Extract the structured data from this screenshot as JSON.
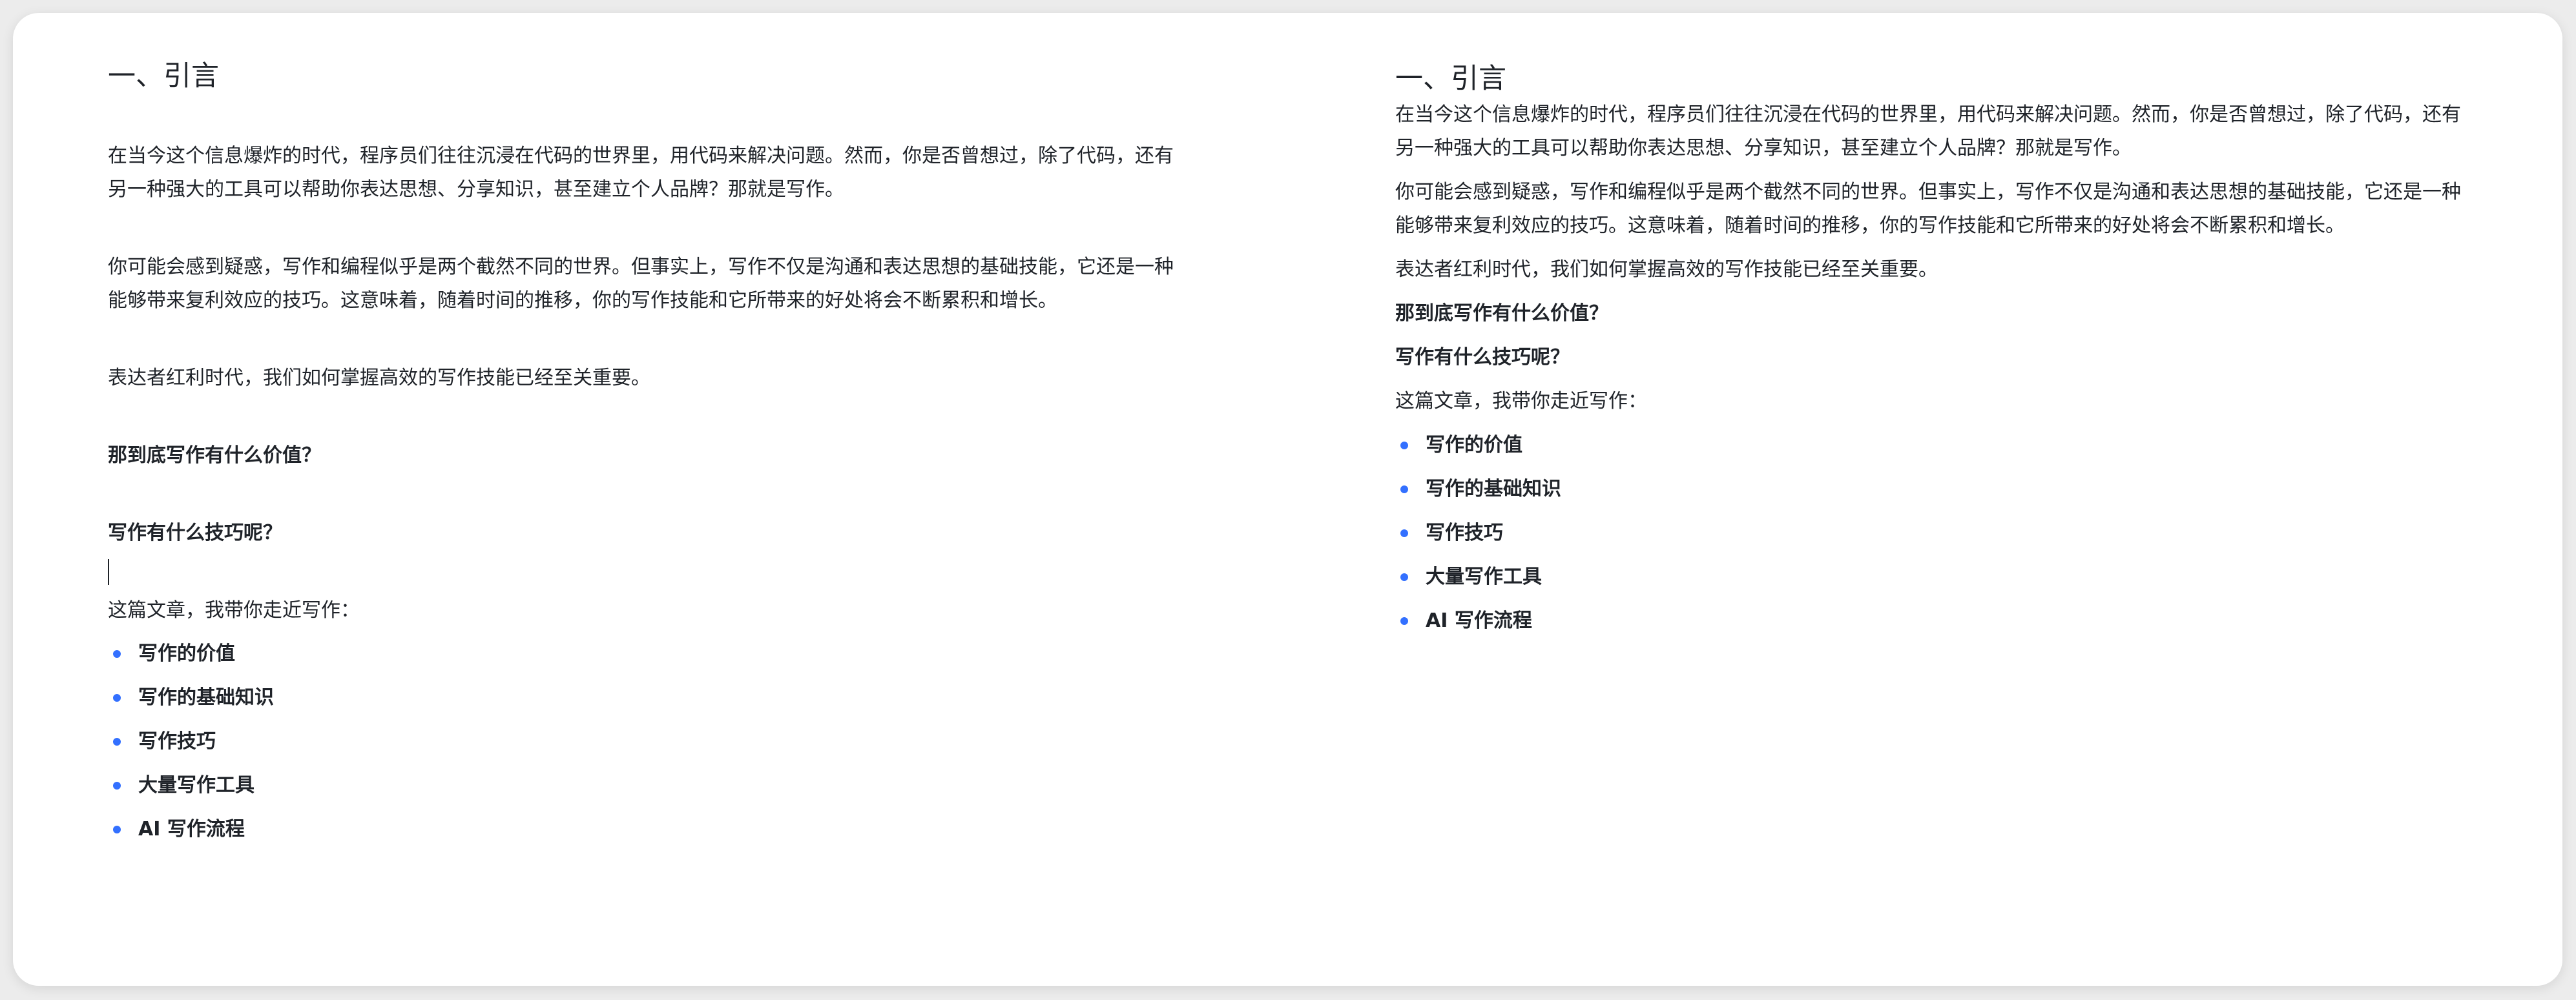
{
  "colors": {
    "text": "#1f2329",
    "bullet": "#3370ff",
    "card_bg": "#ffffff",
    "page_bg": "#ececec"
  },
  "left": {
    "title": "一、引言",
    "p1": "在当今这个信息爆炸的时代，程序员们往往沉浸在代码的世界里，用代码来解决问题。然而，你是否曾想过，除了代码，还有另一种强大的工具可以帮助你表达思想、分享知识，甚至建立个人品牌？那就是写作。",
    "p2": "你可能会感到疑惑，写作和编程似乎是两个截然不同的世界。但事实上，写作不仅是沟通和表达思想的基础技能，它还是一种能够带来复利效应的技巧。这意味着，随着时间的推移，你的写作技能和它所带来的好处将会不断累积和增长。",
    "p3": "表达者红利时代，我们如何掌握高效的写作技能已经至关重要。",
    "q1": "那到底写作有什么价值？",
    "q2": "写作有什么技巧呢？",
    "intro": "这篇文章，我带你走近写作：",
    "items": [
      "写作的价值",
      "写作的基础知识",
      "写作技巧",
      "大量写作工具",
      "AI 写作流程"
    ]
  },
  "right": {
    "title": "一、引言",
    "p1": "在当今这个信息爆炸的时代，程序员们往往沉浸在代码的世界里，用代码来解决问题。然而，你是否曾想过，除了代码，还有另一种强大的工具可以帮助你表达思想、分享知识，甚至建立个人品牌？那就是写作。",
    "p2": "你可能会感到疑惑，写作和编程似乎是两个截然不同的世界。但事实上，写作不仅是沟通和表达思想的基础技能，它还是一种能够带来复利效应的技巧。这意味着，随着时间的推移，你的写作技能和它所带来的好处将会不断累积和增长。",
    "p3": "表达者红利时代，我们如何掌握高效的写作技能已经至关重要。",
    "q1": "那到底写作有什么价值？",
    "q2": "写作有什么技巧呢？",
    "intro": "这篇文章，我带你走近写作：",
    "items": [
      "写作的价值",
      "写作的基础知识",
      "写作技巧",
      "大量写作工具",
      "AI 写作流程"
    ]
  }
}
